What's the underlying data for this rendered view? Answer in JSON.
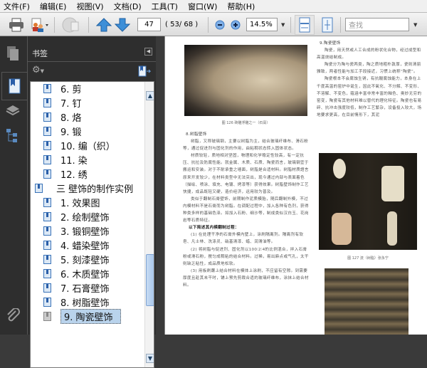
{
  "menu": [
    "文件(F)",
    "编辑(E)",
    "视图(V)",
    "文档(D)",
    "工具(T)",
    "窗口(W)",
    "帮助(H)"
  ],
  "toolbar": {
    "page_number": "47",
    "page_count": "( 53∕ 68 )",
    "zoom": "14.5%",
    "search_placeholder": "查找"
  },
  "bookmarks": {
    "title": "书签",
    "items": [
      {
        "label": "6.  剪",
        "indent": 1
      },
      {
        "label": "7.  钉",
        "indent": 1
      },
      {
        "label": "8.  烙",
        "indent": 1
      },
      {
        "label": "9.  锻",
        "indent": 1
      },
      {
        "label": "10.  编（织）",
        "indent": 1
      },
      {
        "label": "11.  染",
        "indent": 1
      },
      {
        "label": "12.  绣",
        "indent": 1
      },
      {
        "label": "三  壁饰的制作实例",
        "indent": 0
      },
      {
        "label": "1.  效果图",
        "indent": 1
      },
      {
        "label": "2.  绘制壁饰",
        "indent": 1
      },
      {
        "label": "3.  锻铜壁饰",
        "indent": 1
      },
      {
        "label": "4.  蜡染壁饰",
        "indent": 1
      },
      {
        "label": "5.  刻漆壁饰",
        "indent": 1
      },
      {
        "label": "6.  木质壁饰",
        "indent": 1
      },
      {
        "label": "7.  石膏壁饰",
        "indent": 1
      },
      {
        "label": "8.  树脂壁饰",
        "indent": 1
      },
      {
        "label": "9.  陶瓷壁饰",
        "indent": 1,
        "selected": true
      }
    ]
  },
  "document": {
    "caption1": "图 126  砖雕浮雕之一（石膏）",
    "caption2": "图 127  流（树脂）张永宁",
    "left_col": [
      {
        "type": "h",
        "text": "8.树脂壁饰"
      },
      {
        "type": "p",
        "text": "树脂，又称玻璃钢，主要以树脂为主，结合玻璃纤维布、滑石粉等，通过促进剂与固化剂的作用，由粘稠状态转入固体状态。"
      },
      {
        "type": "p",
        "text": "材质较轻，质地相对坚固，物理和化学稳定性较高，有一定抗压、抗拉及防腐性能。就金属、木质、石质、陶瓷而言，玻璃钢宜于搬运和安装。对于不耐承重之墙面，树脂是合适材料。树脂材质語言原来开发较少，在材料类型中无法突出，现今通过内部与表面着色（描绘、喷涂、填充、电镀、烤漆等）获得效果。树脂壁饰制作工艺快捷，成品既轻又硬，造价经济，运用较为普及。"
      },
      {
        "type": "p",
        "text": "类似于翻制石膏壁饰，前期制作泥质模胎，随后翻制外模，不过内模材料不是石膏而为树脂。在调配过程中，加入各种有色剂，获得种类多样的基础色泽。如加入石粉、细沙等，制成类似汉白玉、花岗岩等石质特征。"
      },
      {
        "type": "b",
        "text": "以下简述其内模翻制过程："
      },
      {
        "type": "p",
        "text": "(1) 在处理干净的石膏外模内壁上，涂刷隔离剂。隔离剂有软皂、凡士林、洗涤灵、硝基清漆、蜡、润滑油等。"
      },
      {
        "type": "p",
        "text": "(2) 将树脂与促进剂、固化剂以100∶2∶4的比例混合，拌入石膏粉或滑石粉，搅匀成稠粘的结合材料。过稀，易出麻点或气孔，太干则缺乏粘性，成品质地松软。"
      },
      {
        "type": "p",
        "text": "(3) 用板刷蘸上结合材料在模体上涂刷，不应留有空隙。到需要厚度且趁其未干时，铺上预先剪裁合适的玻璃纤维布，涂抹上结合材料。"
      }
    ],
    "right_col": [
      {
        "type": "h",
        "text": "9.陶瓷壁饰"
      },
      {
        "type": "p",
        "text": "陶瓷，用天然或人工合成的粉状化合物，经过成型和高温烧结制成。"
      },
      {
        "type": "p",
        "text": "陶瓷分为陶与瓷两类，陶之质地粗朴敦厚，瓷则清丽雅致，两者性能与加工手段接近，习惯上统称“陶瓷”。"
      },
      {
        "type": "p",
        "text": "陶瓷根本不会腐蚀生锈，有抗酸腐蚀能力，本身在上千度高温的窑炉中诞生，因此不氧化、不分解、不变形、不溶解、不变色，蕴涵丰富非常丰富的釉色、奥妙无穷的窑变，陶瓷有其他材料难以替代的理化特征。陶瓷也有易碎、抗冲击强度较低，制作工艺繁杂，设备投入较大，场地要求更高，在目前情形下，其泥"
      }
    ]
  },
  "colors": {
    "panel": "#2e2e2e",
    "selection": "#b9d3ec",
    "accent": "#3a73b8"
  }
}
